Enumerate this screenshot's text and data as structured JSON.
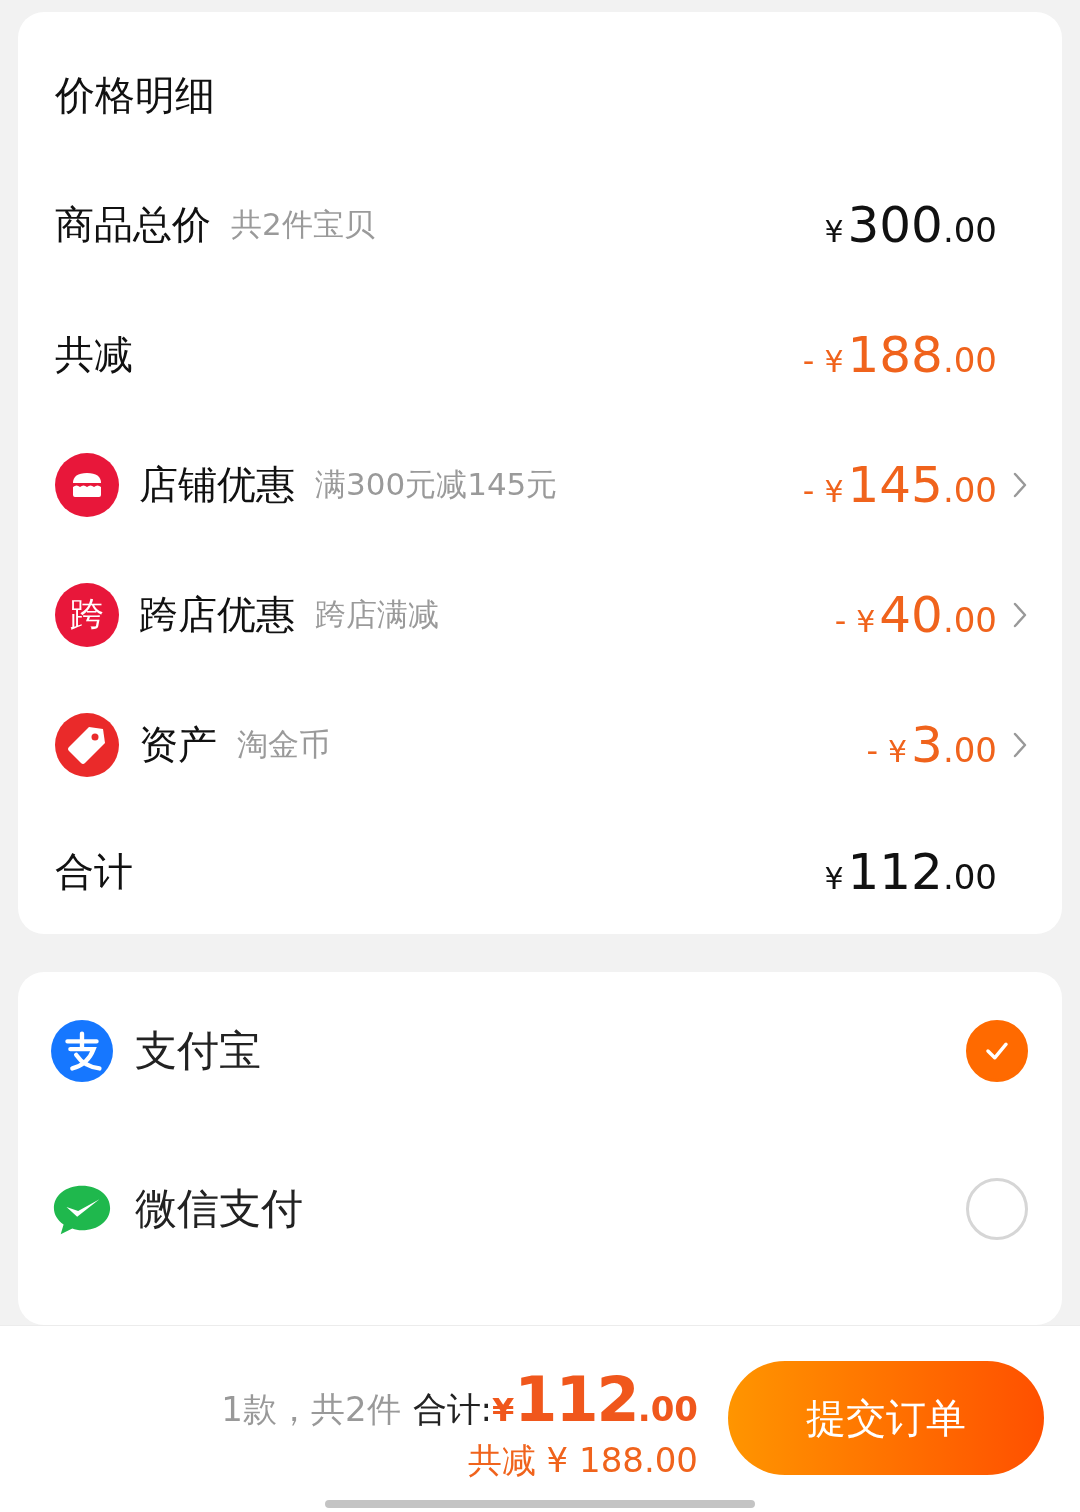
{
  "price_detail": {
    "title": "价格明细",
    "rows": [
      {
        "kind": "plain",
        "label": "商品总价",
        "note": "共2件宝贝",
        "sign": "",
        "currency": "¥",
        "integer": "300",
        "decimal": ".00",
        "discount": false,
        "expandable": false
      },
      {
        "kind": "plain",
        "label": "共减",
        "sign": "-",
        "currency": "¥",
        "integer": "188",
        "decimal": ".00",
        "discount": true,
        "expandable": false
      },
      {
        "kind": "promo",
        "label": "店铺优惠",
        "note": "满300元减145元",
        "sign": "-",
        "currency": "¥",
        "integer": "145",
        "decimal": ".00",
        "discount": true,
        "expandable": true
      },
      {
        "kind": "promo",
        "icon_text": "跨",
        "label": "跨店优惠",
        "note": "跨店满减",
        "sign": "-",
        "currency": "¥",
        "integer": "40",
        "decimal": ".00",
        "discount": true,
        "expandable": true
      },
      {
        "kind": "promo",
        "label": "资产",
        "note": "淘金币",
        "sign": "-",
        "currency": "¥",
        "integer": "3",
        "decimal": ".00",
        "discount": true,
        "expandable": true
      },
      {
        "kind": "plain",
        "label": "合计",
        "sign": "",
        "currency": "¥",
        "integer": "112",
        "decimal": ".00",
        "discount": false,
        "expandable": false
      }
    ]
  },
  "payment_methods": [
    {
      "name": "支付宝",
      "selected": true
    },
    {
      "name": "微信支付",
      "selected": false
    }
  ],
  "footer": {
    "count": "1款，共2件",
    "total_label": "合计:",
    "currency": "¥",
    "integer": "112",
    "decimal": ".00",
    "saved": "共减 ¥ 188.00",
    "submit": "提交订单"
  }
}
